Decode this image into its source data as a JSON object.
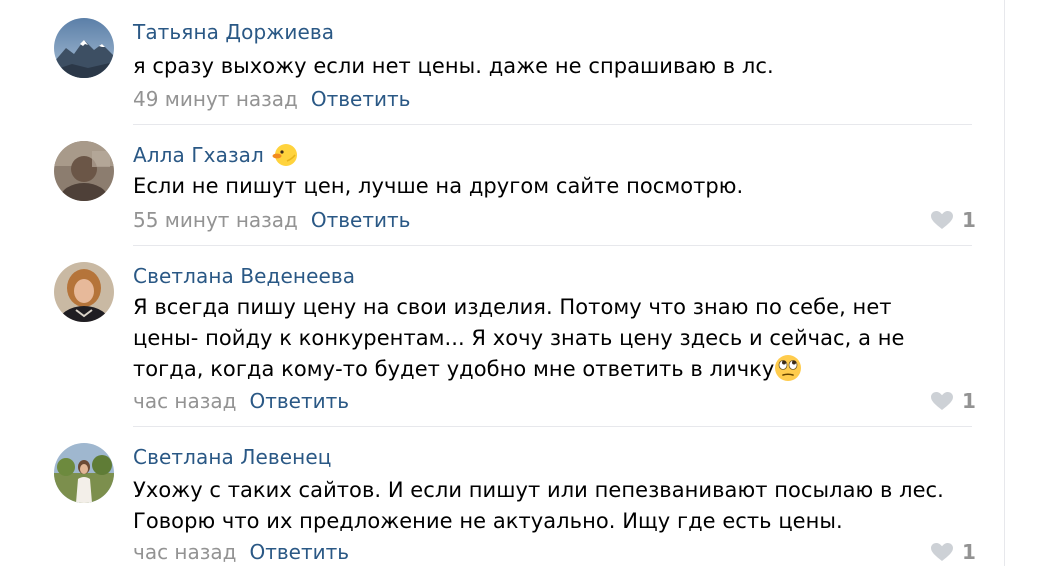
{
  "comments": [
    {
      "author": "Татьяна Доржиева",
      "text_lines": [
        "я сразу выхожу если нет цены. даже не спрашиваю в лс."
      ],
      "time": "49 минут назад",
      "reply_label": "Ответить",
      "likes": "",
      "avatar_icon": "avatar-mountain-photo"
    },
    {
      "author": "Алла Гхазал",
      "author_emoji": "duck-emoji",
      "text_lines": [
        "Если не пишут цен, лучше на другом сайте посмотрю."
      ],
      "time": "55 минут назад",
      "reply_label": "Ответить",
      "likes": "1",
      "avatar_icon": "avatar-photo"
    },
    {
      "author": "Светлана Веденеева",
      "text_lines": [
        "Я всегда пишу цену на свои изделия. Потому что знаю по себе, нет",
        "цены- пойду к конкурентам... Я хочу знать цену здесь и сейчас, а не",
        "тогда, когда кому-то будет удобно мне ответить в личку"
      ],
      "trailing_emoji": "rolling-eyes-emoji",
      "time": "час назад",
      "reply_label": "Ответить",
      "likes": "1",
      "avatar_icon": "avatar-woman-photo"
    },
    {
      "author": "Светлана Левенец",
      "text_lines": [
        "Ухожу с таких сайтов. И если пишут или пепезванивают посылаю в лес.",
        "Говорю что их предложение не актуально. Ищу где есть цены."
      ],
      "time": "час назад",
      "reply_label": "Ответить",
      "likes": "1",
      "avatar_icon": "avatar-woman-outdoor-photo"
    }
  ],
  "colors": {
    "link": "#2a5885",
    "meta": "#939393",
    "divider": "#e7e8ec",
    "text": "#000000"
  }
}
